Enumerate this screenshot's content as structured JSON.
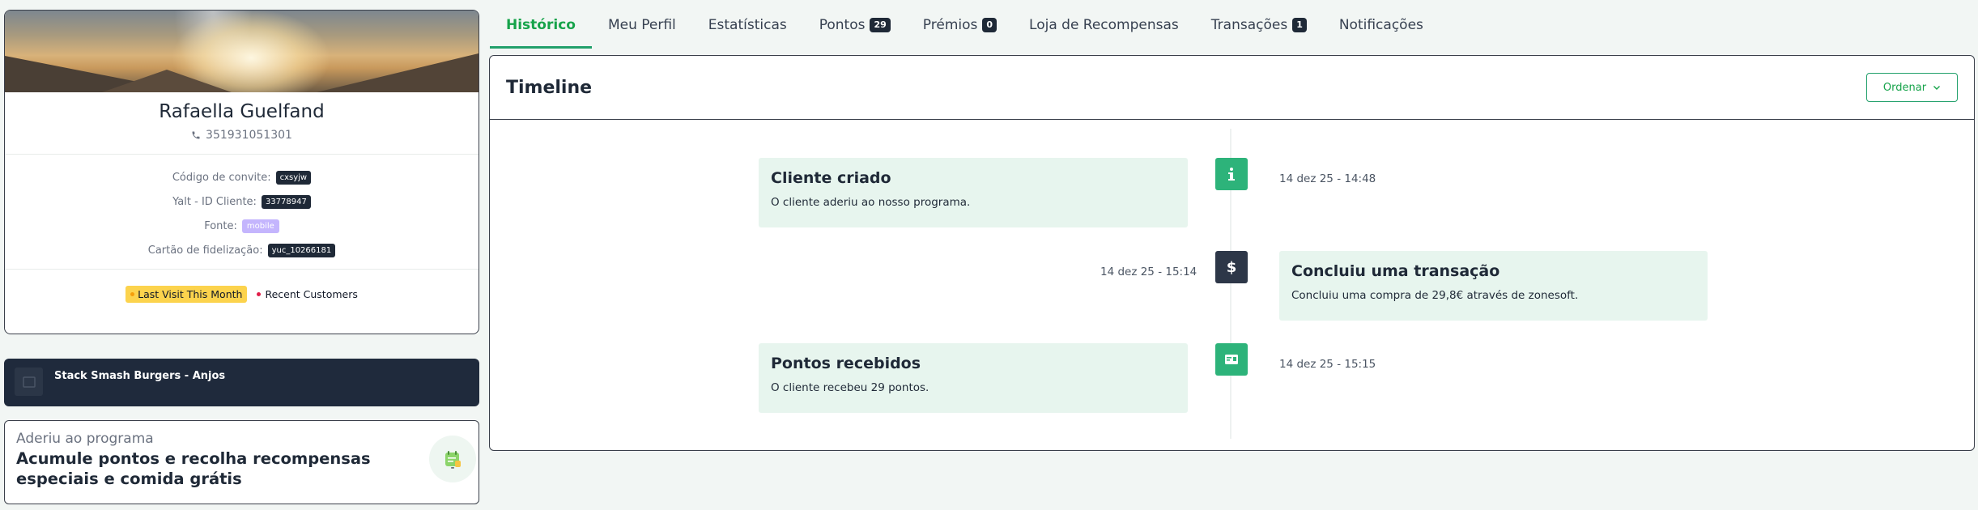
{
  "profile": {
    "name": "Rafaella Guelfand",
    "phone": "351931051301",
    "invite_label": "Código de convite:",
    "invite_code": "cxsyjw",
    "client_id_label": "Yalt - ID Cliente:",
    "client_id": "33778947",
    "source_label": "Fonte:",
    "source": "mobile",
    "card_label": "Cartão de fidelização:",
    "card": "yuc_10266181",
    "segments": [
      {
        "label": "Last Visit This Month",
        "color": "#fcd34d"
      },
      {
        "label": "Recent Customers",
        "color": "#e11d48"
      }
    ]
  },
  "store": {
    "name": "Stack Smash Burgers - Anjos"
  },
  "program": {
    "label": "Aderiu ao programa",
    "description": "Acumule pontos e recolha recompensas especiais e comida grátis",
    "dash": "-"
  },
  "tabs": [
    {
      "label": "Histórico",
      "badge": null,
      "active": true
    },
    {
      "label": "Meu Perfil",
      "badge": null
    },
    {
      "label": "Estatísticas",
      "badge": null
    },
    {
      "label": "Pontos",
      "badge": "29"
    },
    {
      "label": "Prémios",
      "badge": "0"
    },
    {
      "label": "Loja de Recompensas",
      "badge": null
    },
    {
      "label": "Transações",
      "badge": "1"
    },
    {
      "label": "Notificações",
      "badge": null
    }
  ],
  "timeline": {
    "title": "Timeline",
    "sort_label": "Ordenar",
    "events": [
      {
        "title": "Cliente criado",
        "text": "O cliente aderiu ao nosso programa.",
        "time": "14 dez 25 - 14:48",
        "icon": "info-icon"
      },
      {
        "title": "Concluiu uma transação",
        "text": "Concluiu uma compra de 29,8€ através de zonesoft.",
        "time": "14 dez 25 - 15:14",
        "icon": "dollar-icon"
      },
      {
        "title": "Pontos recebidos",
        "text": "O cliente recebeu 29 pontos.",
        "time": "14 dez 25 - 15:15",
        "icon": "card-icon"
      }
    ]
  },
  "colors": {
    "accent": "#22a06b",
    "dark": "#1f2937",
    "event_bg": "#e7f5ee"
  }
}
